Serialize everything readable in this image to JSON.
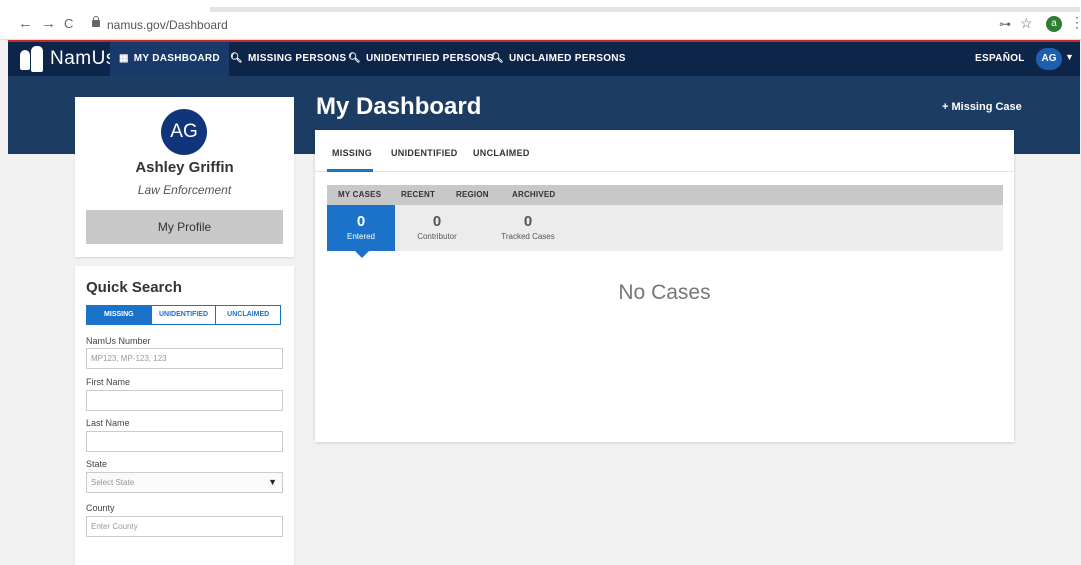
{
  "browser": {
    "back": "←",
    "forward": "→",
    "reload": "C",
    "url": "namus.gov/Dashboard",
    "profile_initial": "a"
  },
  "nav": {
    "logo": "NamUs",
    "items": [
      {
        "label": "MY DASHBOARD",
        "icon": "grid-icon"
      },
      {
        "label": "MISSING PERSONS",
        "icon": "search-icon"
      },
      {
        "label": "UNIDENTIFIED PERSONS",
        "icon": "search-icon"
      },
      {
        "label": "UNCLAIMED PERSONS",
        "icon": "search-icon"
      }
    ],
    "language": "ESPAÑOL",
    "user_initials": "AG"
  },
  "profile": {
    "initials": "AG",
    "name": "Ashley Griffin",
    "role": "Law Enforcement",
    "button": "My Profile"
  },
  "quick_search": {
    "title": "Quick Search",
    "tabs": [
      "MISSING",
      "UNIDENTIFIED",
      "UNCLAIMED"
    ],
    "fields": {
      "namus_label": "NamUs Number",
      "namus_placeholder": "MP123, MP-123, 123",
      "first_label": "First Name",
      "last_label": "Last Name",
      "state_label": "State",
      "state_value": "Select State",
      "county_label": "County",
      "county_placeholder": "Enter County"
    }
  },
  "dashboard": {
    "title": "My Dashboard",
    "add_case": "+ Missing Case",
    "tabs": [
      "MISSING",
      "UNIDENTIFIED",
      "UNCLAIMED"
    ],
    "subtabs": [
      "MY CASES",
      "RECENT",
      "REGION",
      "ARCHIVED"
    ],
    "counts": [
      {
        "value": "0",
        "label": "Entered"
      },
      {
        "value": "0",
        "label": "Contributor"
      },
      {
        "value": "0",
        "label": "Tracked Cases"
      }
    ],
    "empty_message": "No Cases"
  },
  "colors": {
    "nav_bg": "#0d2548",
    "band_bg": "#1d3c64",
    "accent": "#1a73c9"
  }
}
